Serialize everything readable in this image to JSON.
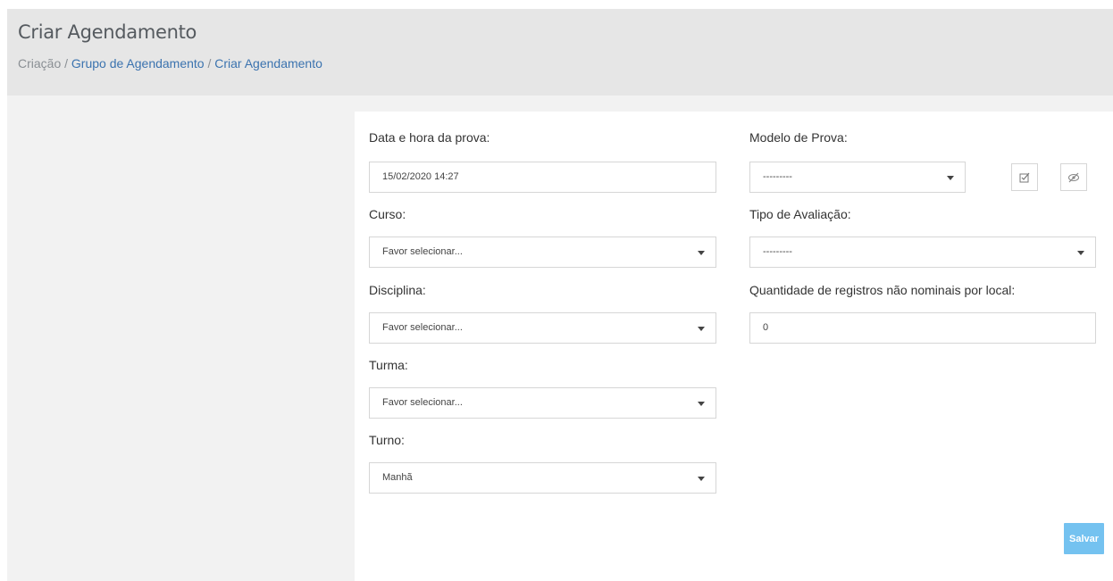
{
  "header": {
    "title": "Criar Agendamento",
    "breadcrumb": {
      "root": "Criação",
      "sep1": "/",
      "link1": "Grupo de Agendamento",
      "sep2": "/",
      "link2": "Criar Agendamento"
    }
  },
  "form": {
    "data_hora": {
      "label": "Data e hora da prova:",
      "value": "15/02/2020 14:27"
    },
    "curso": {
      "label": "Curso:",
      "value": "Favor selecionar..."
    },
    "disciplina": {
      "label": "Disciplina:",
      "value": "Favor selecionar..."
    },
    "turma": {
      "label": "Turma:",
      "value": "Favor selecionar..."
    },
    "turno": {
      "label": "Turno:",
      "value": "Manhã"
    },
    "modelo_prova": {
      "label": "Modelo de Prova:",
      "value": "---------"
    },
    "tipo_avaliacao": {
      "label": "Tipo de Avaliação:",
      "value": "---------"
    },
    "quantidade": {
      "label": "Quantidade de registros não nominais por local:",
      "value": "0"
    },
    "save_label": "Salvar"
  },
  "icons": {
    "check": "check-square-icon",
    "hide": "eye-slash-icon"
  },
  "colors": {
    "link": "#3b73af",
    "save_button": "#74c2f0",
    "header_bg": "#e6e6e6"
  }
}
